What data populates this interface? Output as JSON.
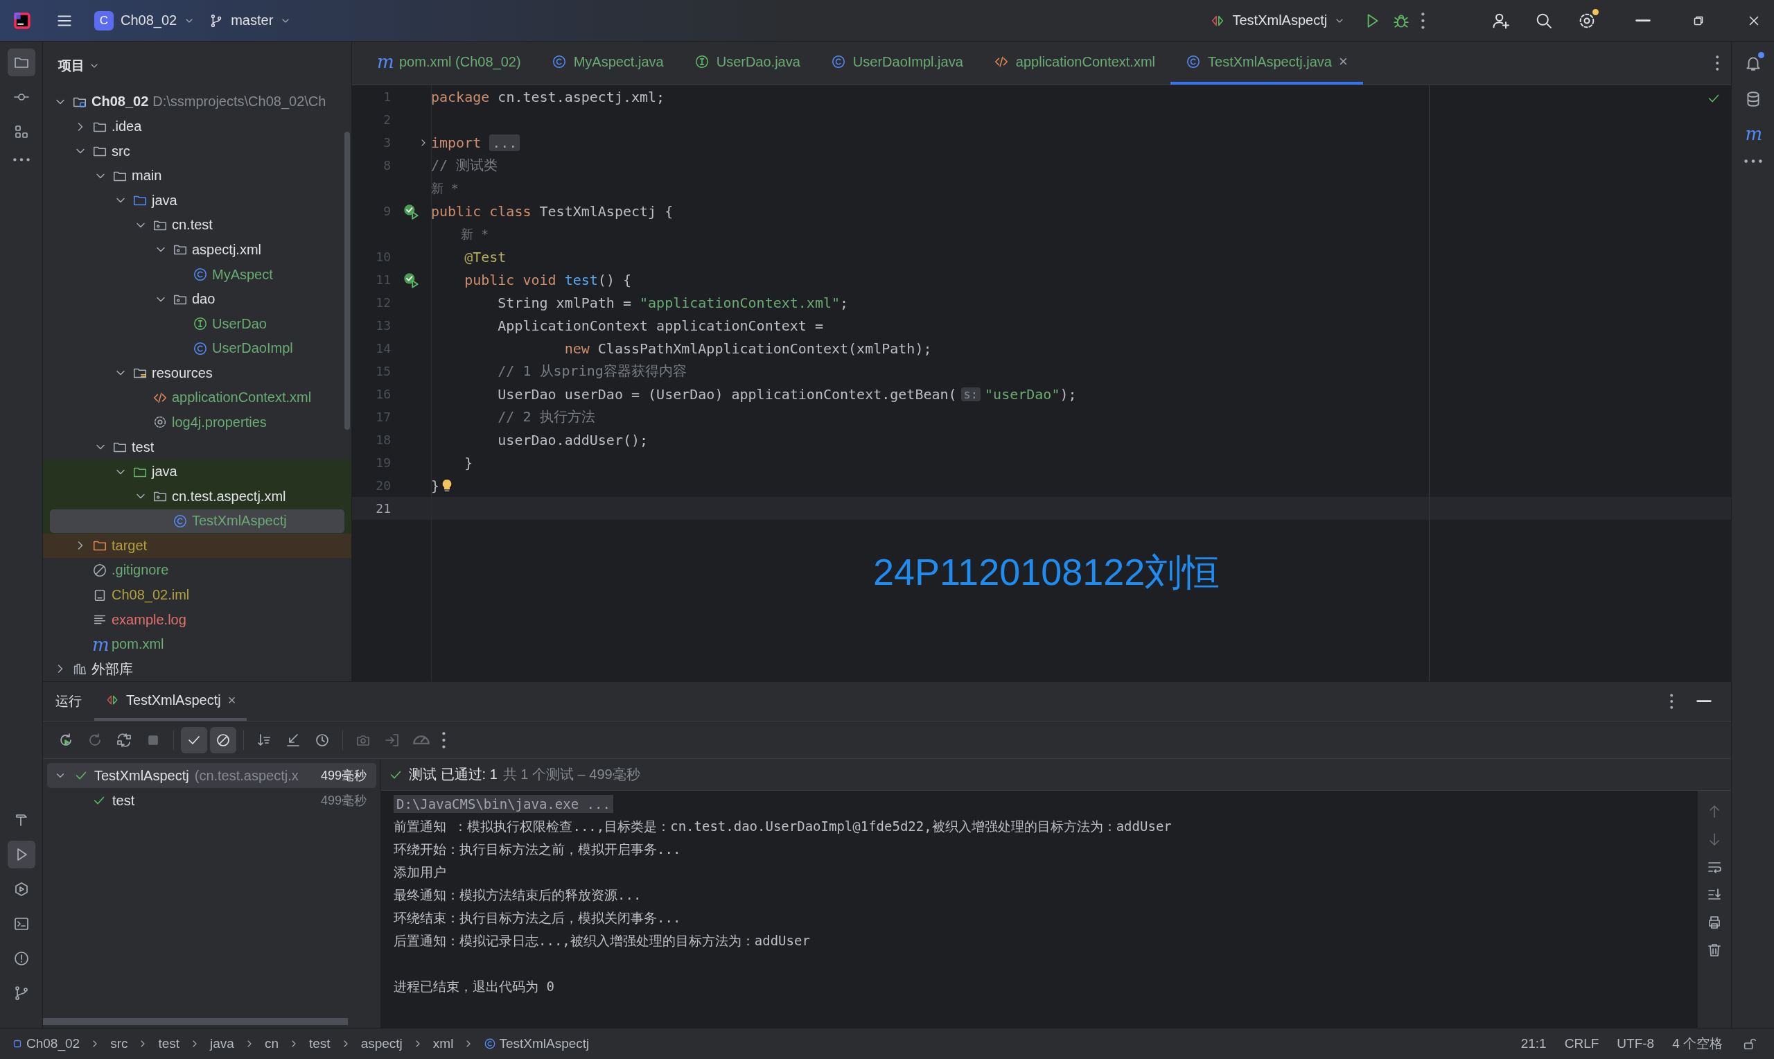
{
  "title_bar": {
    "project_badge": "C",
    "project": "Ch08_02",
    "branch": "master",
    "run_config": "TestXmlAspectj"
  },
  "left_strip": {
    "top": [
      {
        "kind": "folder",
        "selected": true
      },
      {
        "kind": "commit",
        "selected": false
      },
      {
        "kind": "structure",
        "selected": false
      },
      {
        "kind": "more",
        "selected": false
      }
    ],
    "bottom": [
      {
        "kind": "hammer",
        "selected": false
      },
      {
        "kind": "run",
        "selected": true
      },
      {
        "kind": "services",
        "selected": false
      },
      {
        "kind": "terminal",
        "selected": false
      },
      {
        "kind": "problems",
        "selected": false
      },
      {
        "kind": "git",
        "selected": false
      }
    ]
  },
  "right_strip": [
    {
      "kind": "bell",
      "badge": true
    },
    {
      "kind": "database",
      "badge": false
    },
    {
      "kind": "maven",
      "glyph": "m",
      "badge": false
    },
    {
      "kind": "more",
      "badge": false
    }
  ],
  "project_panel": {
    "title": "项目",
    "tree": [
      {
        "label": "Ch08_02",
        "detail": "D:\\ssmprojects\\Ch08_02\\Ch",
        "kind": "module",
        "color": "#dfe1e5",
        "expanded": true,
        "selected": false,
        "children": [
          {
            "label": ".idea",
            "kind": "folder",
            "color": "#dfe1e5",
            "expanded": false,
            "selected": false
          },
          {
            "label": "src",
            "kind": "folder",
            "color": "#dfe1e5",
            "expanded": true,
            "selected": false,
            "children": [
              {
                "label": "main",
                "kind": "folder",
                "color": "#dfe1e5",
                "expanded": true,
                "selected": false,
                "children": [
                  {
                    "label": "java",
                    "kind": "srcfolder",
                    "color": "#dfe1e5",
                    "expanded": true,
                    "selected": false,
                    "children": [
                      {
                        "label": "cn.test",
                        "kind": "package",
                        "color": "#dfe1e5",
                        "expanded": true,
                        "selected": false,
                        "children": [
                          {
                            "label": "aspectj.xml",
                            "kind": "package",
                            "color": "#dfe1e5",
                            "expanded": true,
                            "selected": false,
                            "children": [
                              {
                                "label": "MyAspect",
                                "kind": "class",
                                "color": "#6aab73",
                                "selected": false
                              }
                            ]
                          },
                          {
                            "label": "dao",
                            "kind": "package",
                            "color": "#dfe1e5",
                            "expanded": true,
                            "selected": false,
                            "children": [
                              {
                                "label": "UserDao",
                                "kind": "interface",
                                "color": "#6aab73",
                                "selected": false
                              },
                              {
                                "label": "UserDaoImpl",
                                "kind": "class",
                                "color": "#6aab73",
                                "selected": false
                              }
                            ]
                          }
                        ]
                      }
                    ]
                  },
                  {
                    "label": "resources",
                    "kind": "resfolder",
                    "color": "#dfe1e5",
                    "expanded": true,
                    "selected": false,
                    "children": [
                      {
                        "label": "applicationContext.xml",
                        "kind": "xml",
                        "color": "#6aab73",
                        "selected": false
                      },
                      {
                        "label": "log4j.properties",
                        "kind": "properties",
                        "color": "#6aab73",
                        "selected": false
                      }
                    ]
                  }
                ]
              },
              {
                "label": "test",
                "kind": "folder",
                "color": "#dfe1e5",
                "expanded": true,
                "selected": false,
                "children": [
                  {
                    "label": "java",
                    "kind": "testfolder",
                    "color": "#dfe1e5",
                    "test_source": true,
                    "expanded": true,
                    "selected": false,
                    "children": [
                      {
                        "label": "cn.test.aspectj.xml",
                        "kind": "package",
                        "color": "#dfe1e5",
                        "test_source": true,
                        "expanded": true,
                        "selected": false,
                        "children": [
                          {
                            "label": "TestXmlAspectj",
                            "kind": "class",
                            "color": "#6aab73",
                            "test_source": true,
                            "selected": true
                          }
                        ]
                      }
                    ]
                  }
                ]
              }
            ]
          },
          {
            "label": "target",
            "kind": "excluded",
            "color": "#b4a13f",
            "excluded": true,
            "expanded": false,
            "selected": false
          },
          {
            "label": ".gitignore",
            "kind": "gitignore",
            "color": "#6aab73",
            "selected": false
          },
          {
            "label": "Ch08_02.iml",
            "kind": "iml",
            "color": "#b4a13f",
            "selected": false
          },
          {
            "label": "example.log",
            "kind": "log",
            "color": "#e0716c",
            "selected": false
          },
          {
            "label": "pom.xml",
            "kind": "maven",
            "glyph": "m",
            "color": "#6aab73",
            "selected": false
          }
        ]
      },
      {
        "label": "外部库",
        "kind": "library",
        "color": "#dfe1e5",
        "expanded": false,
        "selected": false
      }
    ]
  },
  "editor": {
    "tabs": [
      {
        "label": "pom.xml (Ch08_02)",
        "kind": "maven",
        "glyph": "m",
        "color": "#6aab73",
        "selected": false
      },
      {
        "label": "MyAspect.java",
        "kind": "class",
        "color": "#6aab73",
        "selected": false
      },
      {
        "label": "UserDao.java",
        "kind": "interface",
        "color": "#6aab73",
        "selected": false
      },
      {
        "label": "UserDaoImpl.java",
        "kind": "class",
        "color": "#6aab73",
        "selected": false
      },
      {
        "label": "applicationContext.xml",
        "kind": "xml",
        "color": "#6aab73",
        "selected": false
      },
      {
        "label": "TestXmlAspectj.java",
        "kind": "class",
        "color": "#6aab73",
        "selected": true,
        "close": "×"
      }
    ],
    "lines": [
      {
        "kind": "code",
        "number": "1",
        "current": false,
        "tokens": [
          {
            "kind": "keyword",
            "text": "package"
          },
          {
            "kind": "plain",
            "text": " cn.test.aspectj.xml;"
          }
        ]
      },
      {
        "kind": "code",
        "number": "2",
        "current": false
      },
      {
        "kind": "code",
        "number": "3",
        "foldable": true,
        "current": false,
        "tokens": [
          {
            "kind": "keyword",
            "text": "import"
          },
          {
            "kind": "fold",
            "text": "..."
          }
        ]
      },
      {
        "kind": "code",
        "number": "8",
        "current": false,
        "tokens": [
          {
            "kind": "comment",
            "text": "// 测试类"
          }
        ]
      },
      {
        "kind": "hint",
        "current": false,
        "text": "新 *"
      },
      {
        "kind": "code",
        "number": "9",
        "run_marker": true,
        "current": false,
        "tokens": [
          {
            "kind": "keyword",
            "text": "public class"
          },
          {
            "kind": "plain",
            "text": " TestXmlAspectj {"
          }
        ]
      },
      {
        "kind": "hint",
        "current": false,
        "text": "    新 *"
      },
      {
        "kind": "code",
        "number": "10",
        "current": false,
        "tokens": [
          {
            "kind": "annotation",
            "text": "    @Test"
          }
        ]
      },
      {
        "kind": "code",
        "number": "11",
        "run_marker": true,
        "current": false,
        "tokens": [
          {
            "kind": "keyword",
            "text": "    public void"
          },
          {
            "kind": "method",
            "text": " test"
          },
          {
            "kind": "plain",
            "text": "() {"
          }
        ]
      },
      {
        "kind": "code",
        "number": "12",
        "current": false,
        "tokens": [
          {
            "kind": "plain",
            "text": "        String xmlPath = "
          },
          {
            "kind": "string",
            "text": "\"applicationContext.xml\""
          },
          {
            "kind": "plain",
            "text": ";"
          }
        ]
      },
      {
        "kind": "code",
        "number": "13",
        "current": false,
        "tokens": [
          {
            "kind": "plain",
            "text": "        ApplicationContext applicationContext ="
          }
        ]
      },
      {
        "kind": "code",
        "number": "14",
        "current": false,
        "tokens": [
          {
            "kind": "keyword",
            "text": "                new"
          },
          {
            "kind": "plain",
            "text": " ClassPathXmlApplicationContext(xmlPath);"
          }
        ]
      },
      {
        "kind": "code",
        "number": "15",
        "current": false,
        "tokens": [
          {
            "kind": "comment",
            "text": "        // 1 从spring容器获得内容"
          }
        ]
      },
      {
        "kind": "code",
        "number": "16",
        "current": false,
        "tokens": [
          {
            "kind": "plain",
            "text": "        UserDao userDao = (UserDao) applicationContext.getBean("
          },
          {
            "kind": "hint",
            "text": "s:"
          },
          {
            "kind": "string",
            "text": "\"userDao\""
          },
          {
            "kind": "plain",
            "text": ");"
          }
        ]
      },
      {
        "kind": "code",
        "number": "17",
        "current": false,
        "tokens": [
          {
            "kind": "comment",
            "text": "        // 2 执行方法"
          }
        ]
      },
      {
        "kind": "code",
        "number": "18",
        "current": false,
        "tokens": [
          {
            "kind": "plain",
            "text": "        userDao.addUser();"
          }
        ]
      },
      {
        "kind": "code",
        "number": "19",
        "current": false,
        "tokens": [
          {
            "kind": "plain",
            "text": "    }"
          }
        ]
      },
      {
        "kind": "code",
        "number": "20",
        "current": false,
        "tokens": [
          {
            "kind": "plain",
            "text": "}"
          },
          {
            "kind": "bulb"
          }
        ]
      },
      {
        "kind": "code",
        "number": "21",
        "current": true
      }
    ]
  },
  "run_panel": {
    "title": "运行",
    "tabs": [
      {
        "label": "TestXmlAspectj",
        "selected": true,
        "close": "×"
      }
    ],
    "toolbar": [
      {
        "kind": "rerun",
        "disabled": false
      },
      {
        "kind": "rerun-failed",
        "disabled": true
      },
      {
        "kind": "toggle",
        "disabled": false
      },
      {
        "kind": "stop",
        "disabled": true
      },
      {
        "kind": "check",
        "selected": true,
        "disabled": false
      },
      {
        "kind": "prohibited",
        "selected": true,
        "disabled": false
      },
      {
        "kind": "sort",
        "disabled": false
      },
      {
        "kind": "collapse",
        "disabled": false
      },
      {
        "kind": "clock",
        "disabled": false
      },
      {
        "kind": "camera",
        "disabled": true
      },
      {
        "kind": "import",
        "disabled": true
      },
      {
        "kind": "gauge",
        "disabled": true
      },
      {
        "kind": "more",
        "disabled": false
      }
    ],
    "tests": [
      {
        "label": "TestXmlAspectj",
        "detail": "(cn.test.aspectj.x",
        "time": "499毫秒",
        "passed": true,
        "expanded": true,
        "selected": true,
        "children": [
          {
            "label": "test",
            "time": "499毫秒",
            "passed": true,
            "selected": false
          }
        ]
      }
    ],
    "summary": {
      "passed": "测试 已通过: 1",
      "detail": "共 1 个测试 – 499毫秒"
    },
    "console": [
      {
        "kind": "command",
        "text": "D:\\JavaCMS\\bin\\java.exe ..."
      },
      {
        "kind": "output",
        "text": "前置通知 ：模拟执行权限检查...,目标类是：cn.test.dao.UserDaoImpl@1fde5d22,被织入增强处理的目标方法为：addUser"
      },
      {
        "kind": "output",
        "text": "环绕开始：执行目标方法之前，模拟开启事务..."
      },
      {
        "kind": "output",
        "text": "添加用户"
      },
      {
        "kind": "output",
        "text": "最终通知：模拟方法结束后的释放资源..."
      },
      {
        "kind": "output",
        "text": "环绕结束：执行目标方法之后，模拟关闭事务..."
      },
      {
        "kind": "output",
        "text": "后置通知：模拟记录日志...,被织入增强处理的目标方法为：addUser"
      },
      {
        "kind": "blank"
      },
      {
        "kind": "output",
        "text": "进程已结束，退出代码为 0"
      }
    ],
    "console_tools": [
      {
        "kind": "arrow-up",
        "disabled": true
      },
      {
        "kind": "arrow-down",
        "disabled": true
      },
      {
        "kind": "wrap",
        "disabled": false
      },
      {
        "kind": "scroll-end",
        "disabled": false
      },
      {
        "kind": "print",
        "disabled": false
      },
      {
        "kind": "trash",
        "disabled": false
      }
    ]
  },
  "status_bar": {
    "breadcrumbs": [
      {
        "label": "Ch08_02",
        "kind": "module-square"
      },
      {
        "label": "src"
      },
      {
        "label": "test"
      },
      {
        "label": "java"
      },
      {
        "label": "cn"
      },
      {
        "label": "test"
      },
      {
        "label": "aspectj"
      },
      {
        "label": "xml"
      },
      {
        "label": "TestXmlAspectj",
        "kind": "class"
      }
    ],
    "position": "21:1",
    "line_ending": "CRLF",
    "encoding": "UTF-8",
    "indent": "4 个空格"
  },
  "overlay_label": "24P1120108122刘恒"
}
